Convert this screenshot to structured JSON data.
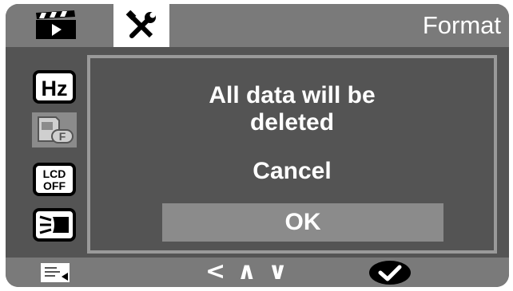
{
  "header": {
    "title": "Format",
    "tabs": [
      {
        "name": "video-icon",
        "active": false
      },
      {
        "name": "tools-icon",
        "active": true
      }
    ]
  },
  "sidebar": {
    "items": [
      {
        "icon": "hz-icon",
        "label": "Hz"
      },
      {
        "icon": "format-card-icon",
        "label": "F",
        "active": true
      },
      {
        "icon": "lcd-off-icon",
        "label_top": "LCD",
        "label_bottom": "OFF"
      },
      {
        "icon": "headlight-icon"
      }
    ]
  },
  "dialog": {
    "message_line1": "All data will be",
    "message_line2": "deleted",
    "options": [
      {
        "label": "Cancel",
        "selected": false
      },
      {
        "label": "OK",
        "selected": true
      }
    ]
  },
  "footer": {
    "nav_symbols": "< ∧ ∨",
    "icons": [
      "menu-icon",
      "navigation-icon",
      "confirm-icon"
    ]
  },
  "colors": {
    "screen_bg": "#545454",
    "bar_bg": "#7a7a7a",
    "highlight": "#8b8b8b",
    "border": "#9a9a9a",
    "text": "#ffffff"
  }
}
